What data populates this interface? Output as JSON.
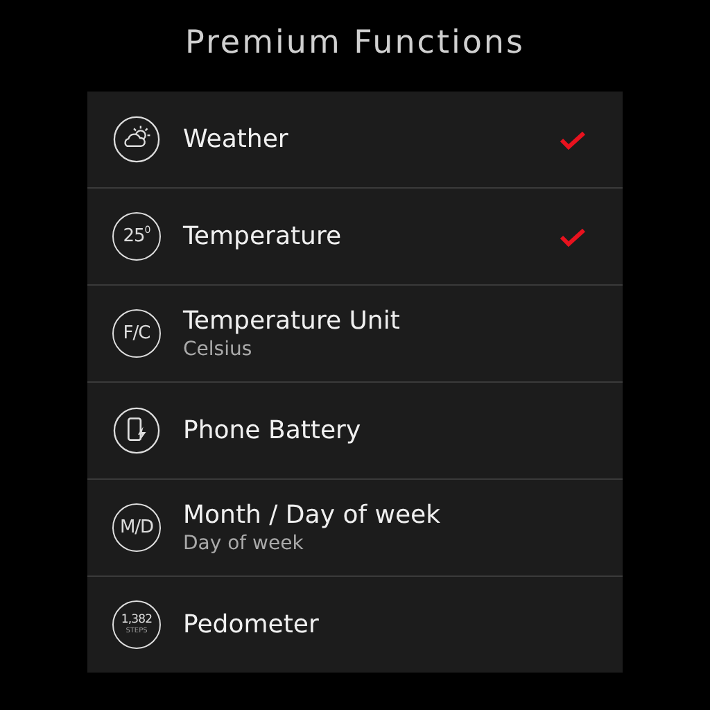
{
  "title": "Premium Functions",
  "items": [
    {
      "icon": {
        "kind": "weather"
      },
      "title": "Weather",
      "checked": true
    },
    {
      "icon": {
        "kind": "text",
        "text": "25",
        "sup": "0"
      },
      "title": "Temperature",
      "checked": true
    },
    {
      "icon": {
        "kind": "text",
        "text": "F/C"
      },
      "title": "Temperature Unit",
      "subtitle": "Celsius",
      "checked": false
    },
    {
      "icon": {
        "kind": "battery"
      },
      "title": "Phone Battery",
      "checked": false
    },
    {
      "icon": {
        "kind": "text",
        "text": "M/D"
      },
      "title": "Month / Day of week",
      "subtitle": "Day of week",
      "checked": false
    },
    {
      "icon": {
        "kind": "steps",
        "text": "1,382",
        "caption": "STEPS"
      },
      "title": "Pedometer",
      "checked": false
    }
  ]
}
